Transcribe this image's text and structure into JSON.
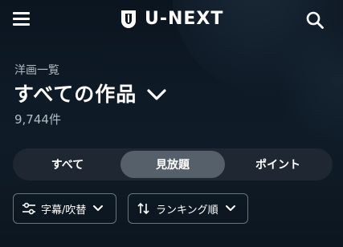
{
  "header": {
    "logo_text": "U-NEXT",
    "menu_icon": "hamburger-menu-icon",
    "search_icon": "search-icon"
  },
  "page": {
    "subtitle": "洋画一覧",
    "title": "すべての作品",
    "count": "9,744件"
  },
  "tabs": [
    {
      "label": "すべて",
      "selected": false
    },
    {
      "label": "見放題",
      "selected": true
    },
    {
      "label": "ポイント",
      "selected": false
    }
  ],
  "filters": {
    "subtitle_dub": {
      "label": "字幕/吹替",
      "icon": "sliders-icon"
    },
    "sort": {
      "label": "ランキング順",
      "icon": "sort-arrows-icon"
    }
  },
  "colors": {
    "background": "#0c1722",
    "tab_track": "#1f2832",
    "tab_selected": "#56606a",
    "muted_text": "#b4bcc4"
  }
}
